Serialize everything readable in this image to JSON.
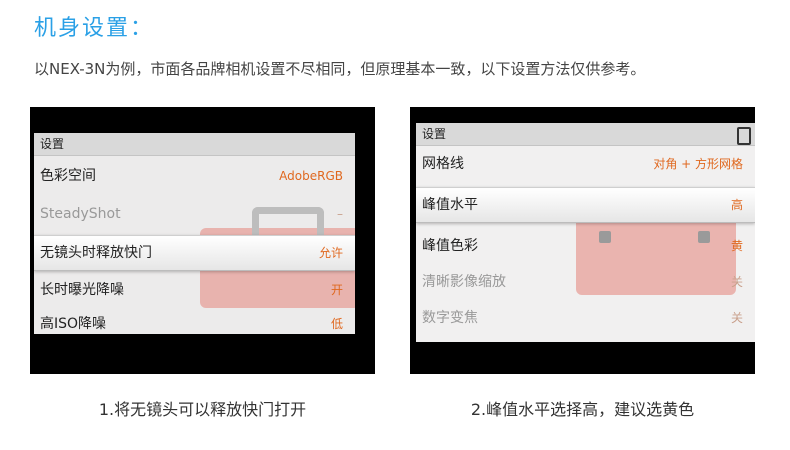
{
  "heading": "机身设置：",
  "description": "以NEX-3N为例，市面各品牌相机设置不尽相同，但原理基本一致，以下设置方法仅供参考。",
  "screens": [
    {
      "header": "设置",
      "rows": [
        {
          "label": "色彩空间",
          "value": "AdobeRGB"
        },
        {
          "label": "SteadyShot",
          "value": "–"
        },
        {
          "label": "无镜头时释放快门",
          "value": "允许"
        },
        {
          "label": "长时曝光降噪",
          "value": "开"
        },
        {
          "label": "高ISO降噪",
          "value": "低"
        }
      ],
      "caption": "1.将无镜头可以释放快门打开"
    },
    {
      "header": "设置",
      "rows": [
        {
          "label": "网格线",
          "value": "对角 + 方形网格"
        },
        {
          "label": "峰值水平",
          "value": "高"
        },
        {
          "label": "峰值色彩",
          "value": "黄"
        },
        {
          "label": "清晰影像缩放",
          "value": "关"
        },
        {
          "label": "数字变焦",
          "value": "关"
        }
      ],
      "caption": "2.峰值水平选择高，建议选黄色"
    }
  ],
  "colors": {
    "heading": "#2aa0e6",
    "value_text": "#e0681f"
  }
}
